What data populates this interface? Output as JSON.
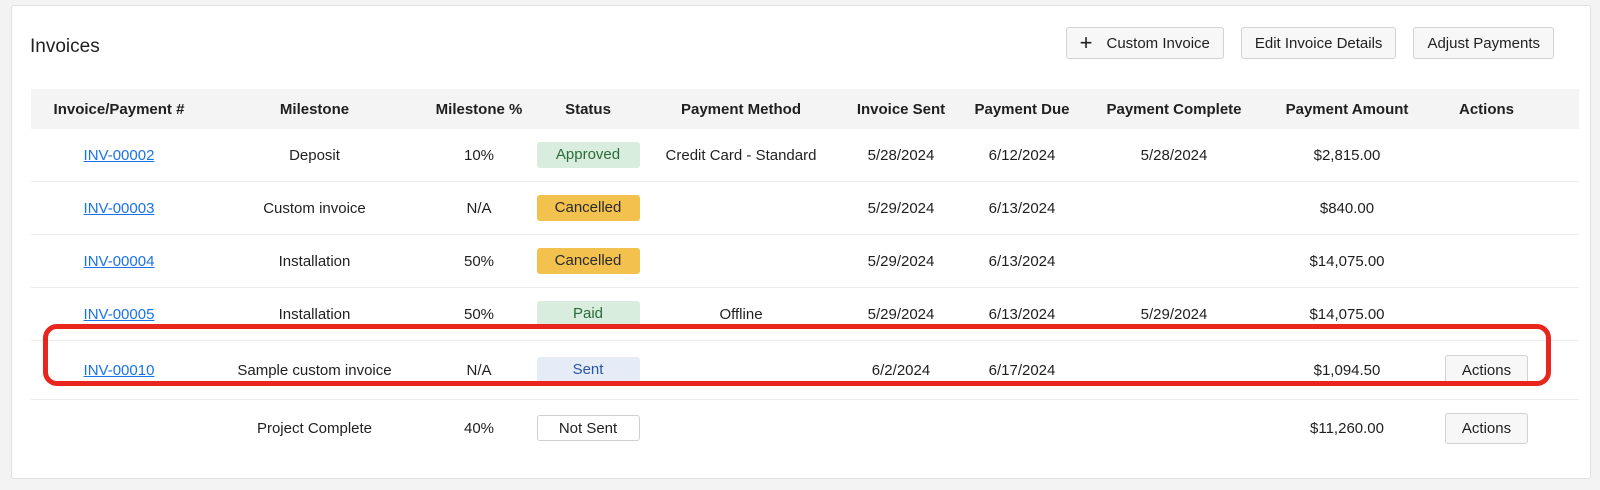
{
  "card": {
    "title": "Invoices"
  },
  "toolbar": {
    "custom_invoice": "Custom Invoice",
    "edit_details": "Edit Invoice Details",
    "adjust_payments": "Adjust Payments"
  },
  "table": {
    "headers": [
      "Invoice/Payment #",
      "Milestone",
      "Milestone %",
      "Status",
      "Payment Method",
      "Invoice Sent",
      "Payment Due",
      "Payment Complete",
      "Payment Amount",
      "Actions"
    ],
    "rows": [
      {
        "invoice": "INV-00002",
        "milestone": "Deposit",
        "pct": "10%",
        "status": "Approved",
        "method": "Credit Card - Standard",
        "sent": "5/28/2024",
        "due": "6/12/2024",
        "complete": "5/28/2024",
        "amount": "$2,815.00",
        "action": ""
      },
      {
        "invoice": "INV-00003",
        "milestone": "Custom invoice",
        "pct": "N/A",
        "status": "Cancelled",
        "method": "",
        "sent": "5/29/2024",
        "due": "6/13/2024",
        "complete": "",
        "amount": "$840.00",
        "action": ""
      },
      {
        "invoice": "INV-00004",
        "milestone": "Installation",
        "pct": "50%",
        "status": "Cancelled",
        "method": "",
        "sent": "5/29/2024",
        "due": "6/13/2024",
        "complete": "",
        "amount": "$14,075.00",
        "action": ""
      },
      {
        "invoice": "INV-00005",
        "milestone": "Installation",
        "pct": "50%",
        "status": "Paid",
        "method": "Offline",
        "sent": "5/29/2024",
        "due": "6/13/2024",
        "complete": "5/29/2024",
        "amount": "$14,075.00",
        "action": ""
      },
      {
        "invoice": "INV-00010",
        "milestone": "Sample custom invoice",
        "pct": "N/A",
        "status": "Sent",
        "method": "",
        "sent": "6/2/2024",
        "due": "6/17/2024",
        "complete": "",
        "amount": "$1,094.50",
        "action": "Actions"
      },
      {
        "invoice": "",
        "milestone": "Project Complete",
        "pct": "40%",
        "status": "Not Sent",
        "method": "",
        "sent": "",
        "due": "",
        "complete": "",
        "amount": "$11,260.00",
        "action": "Actions"
      }
    ]
  },
  "colors": {
    "highlight": "#e8261d",
    "link": "#1a73e8",
    "approved": "#d8eddd",
    "cancelled": "#f2c14e",
    "sent": "#e6ecf7"
  }
}
